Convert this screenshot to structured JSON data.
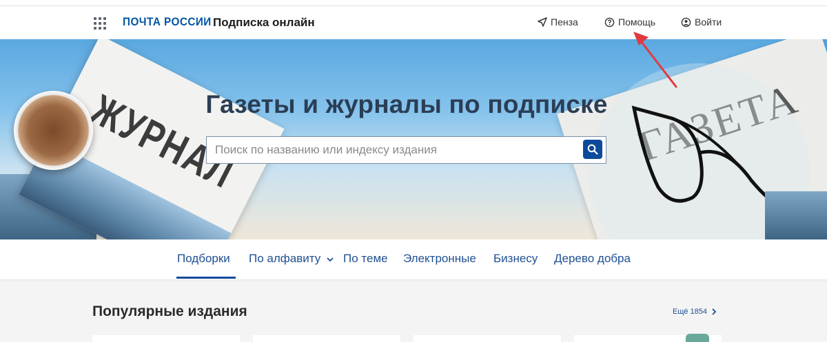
{
  "header": {
    "logo": "ПОЧТА РОССИИ",
    "service_title": "Подписка онлайн",
    "city": "Пенза",
    "help": "Помощь",
    "login": "Войти"
  },
  "hero": {
    "title": "Газеты и журналы по подписке",
    "search_placeholder": "Поиск по названию или индексу издания",
    "magazine_word": "ЖУРНАЛ",
    "newspaper_word": "ГАЗЕТА"
  },
  "tabs": [
    {
      "label": "Подборки",
      "active": true
    },
    {
      "label": "По алфавиту",
      "has_dropdown": true
    },
    {
      "label": "По теме"
    },
    {
      "label": "Электронные"
    },
    {
      "label": "Бизнесу"
    },
    {
      "label": "Дерево добра"
    }
  ],
  "popular": {
    "title": "Популярные издания",
    "more_label": "Ещё 1854"
  },
  "colors": {
    "brand_blue": "#0055a6",
    "accent_blue": "#0d4a9c",
    "annotation_arrow": "#e0393e"
  },
  "icons": [
    "apps-grid-icon",
    "location-arrow-icon",
    "help-circle-icon",
    "user-icon",
    "search-icon",
    "chevron-down-icon",
    "chevron-right-icon"
  ]
}
